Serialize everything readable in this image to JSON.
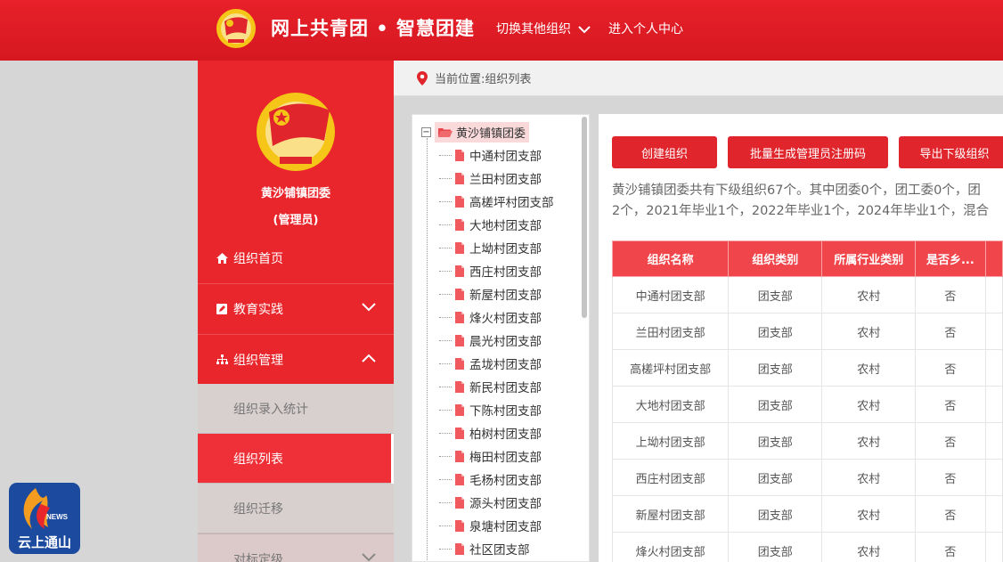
{
  "header": {
    "site_title": "网上共青团 • 智慧团建",
    "switch_org": "切换其他组织",
    "personal_center": "进入个人中心"
  },
  "sidebar": {
    "org_name": "黄沙铺镇团委",
    "role": "(管理员)",
    "menu": [
      {
        "label": "组织首页",
        "icon": "home-icon"
      },
      {
        "label": "教育实践",
        "icon": "edit-icon",
        "chevron": "down"
      },
      {
        "label": "组织管理",
        "icon": "sitemap-icon",
        "chevron": "up"
      }
    ],
    "submenu": [
      {
        "label": "组织录入统计",
        "active": false
      },
      {
        "label": "组织列表",
        "active": true
      },
      {
        "label": "组织迁移",
        "active": false
      }
    ],
    "more_item": "对标定级"
  },
  "breadcrumb": {
    "text": "当前位置:组织列表"
  },
  "tree": {
    "root": "黄沙铺镇团委",
    "nodes": [
      "中通村团支部",
      "兰田村团支部",
      "高槎坪村团支部",
      "大地村团支部",
      "上坳村团支部",
      "西庄村团支部",
      "新屋村团支部",
      "烽火村团支部",
      "晨光村团支部",
      "孟垅村团支部",
      "新民村团支部",
      "下陈村团支部",
      "柏树村团支部",
      "梅田村团支部",
      "毛杨村团支部",
      "源头村团支部",
      "泉塘村团支部",
      "社区团支部"
    ]
  },
  "actions": {
    "create": "创建组织",
    "batch": "批量生成管理员注册码",
    "export": "导出下级组织"
  },
  "summary": {
    "line1": "黄沙铺镇团委共有下级组织67个。其中团委0个，团工委0个，团",
    "line2": "2个，2021年毕业1个，2022年毕业1个，2024年毕业1个，混合"
  },
  "table": {
    "headers": [
      "组织名称",
      "组织类别",
      "所属行业类别",
      "是否乡..."
    ],
    "rows": [
      [
        "中通村团支部",
        "团支部",
        "农村",
        "否"
      ],
      [
        "兰田村团支部",
        "团支部",
        "农村",
        "否"
      ],
      [
        "高槎坪村团支部",
        "团支部",
        "农村",
        "否"
      ],
      [
        "大地村团支部",
        "团支部",
        "农村",
        "否"
      ],
      [
        "上坳村团支部",
        "团支部",
        "农村",
        "否"
      ],
      [
        "西庄村团支部",
        "团支部",
        "农村",
        "否"
      ],
      [
        "新屋村团支部",
        "团支部",
        "农村",
        "否"
      ],
      [
        "烽火村团支部",
        "团支部",
        "农村",
        "否"
      ]
    ]
  },
  "watermark": {
    "news": "NEWS",
    "text": "云上通山"
  },
  "colors": {
    "brand_red": "#e0252c",
    "table_header": "#f0454a",
    "active_menu": "#f03038"
  }
}
